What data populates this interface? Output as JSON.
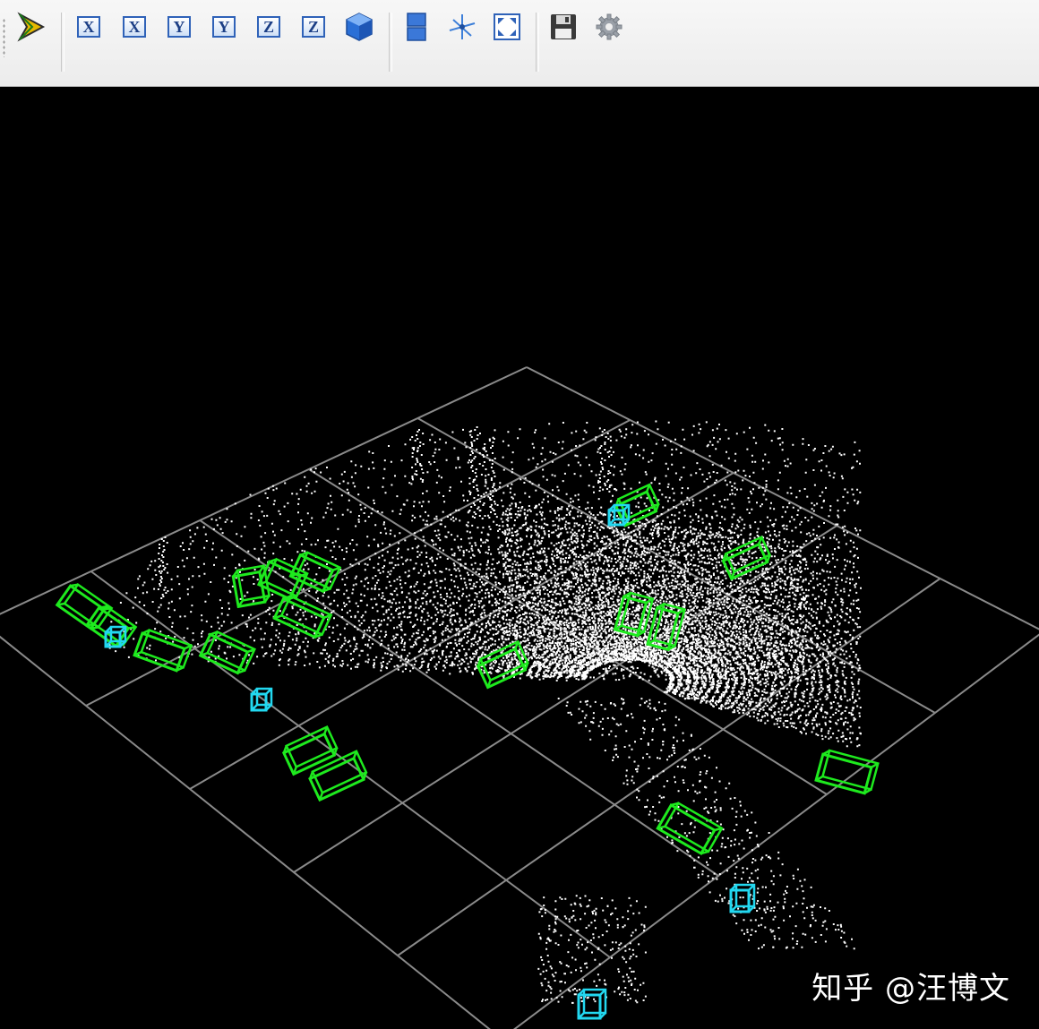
{
  "colors": {
    "toolbar_bg": "#efefef",
    "viewport_bg": "#000000",
    "grid": "#8a8a8a",
    "points": "#ffffff",
    "car_box": "#1eea1e",
    "pedestrian_box": "#22d8f0"
  },
  "toolbar": {
    "buttons": [
      {
        "name": "pick-arrow-icon",
        "icon": "arrow"
      },
      {
        "name": "view-x-pos-button",
        "label": "X"
      },
      {
        "name": "view-x-neg-button",
        "label": "X"
      },
      {
        "name": "view-y-pos-button",
        "label": "Y"
      },
      {
        "name": "view-y-neg-button",
        "label": "Y"
      },
      {
        "name": "view-z-pos-button",
        "label": "Z"
      },
      {
        "name": "view-z-neg-button",
        "label": "Z"
      },
      {
        "name": "view-iso-button",
        "icon": "cube-icon"
      },
      {
        "name": "split-view-button",
        "icon": "split-icon"
      },
      {
        "name": "reset-view-button",
        "icon": "axes-icon"
      },
      {
        "name": "fullscreen-button",
        "icon": "fullscreen-icon"
      },
      {
        "name": "save-button",
        "icon": "floppy-icon"
      },
      {
        "name": "settings-button",
        "icon": "gear-icon"
      }
    ]
  },
  "watermark": {
    "text": "知乎 @汪博文"
  }
}
